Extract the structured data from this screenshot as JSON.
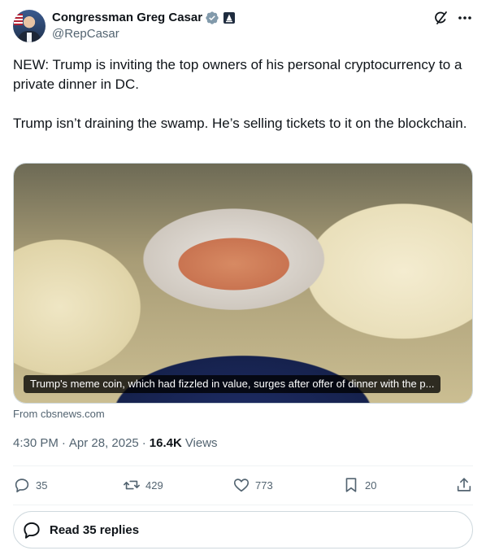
{
  "author": {
    "display_name": "Congressman Greg Casar",
    "handle": "@RepCasar",
    "verified_icon": "gray-verified-checkmark-icon",
    "affiliation_icon": "government-badge-icon"
  },
  "top_actions": {
    "grok_icon": "grok-slash-icon",
    "more_icon": "more-dots-icon"
  },
  "tweet": {
    "paragraphs": [
      "NEW: Trump is inviting the top owners of his personal cryptocurrency to a private dinner in DC.",
      "Trump isn’t draining the swamp. He’s selling tickets to it on the blockchain."
    ]
  },
  "card": {
    "caption": "Trump's meme coin, which had fizzled in value, surges after offer of dinner with the p...",
    "source": "From cbsnews.com"
  },
  "meta": {
    "time": "4:30 PM",
    "date": "Apr 28, 2025",
    "separator": "·",
    "views_count": "16.4K",
    "views_label": "Views"
  },
  "actions": {
    "replies": "35",
    "reposts": "429",
    "likes": "773",
    "bookmarks": "20"
  },
  "read_replies": {
    "label": "Read 35 replies"
  },
  "colors": {
    "text_primary": "#0f1419",
    "text_secondary": "#536471",
    "border": "#cfd9de",
    "divider": "#eff3f4"
  }
}
